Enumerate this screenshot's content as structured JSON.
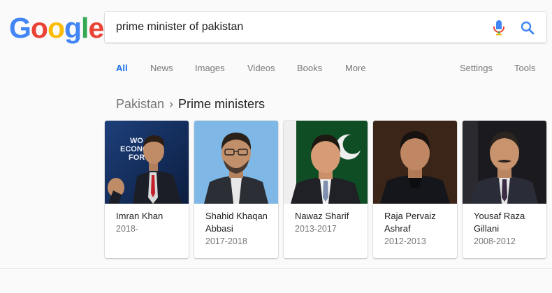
{
  "logo": {
    "letters": [
      {
        "char": "G",
        "color": "#4285F4"
      },
      {
        "char": "o",
        "color": "#EA4335"
      },
      {
        "char": "o",
        "color": "#FBBC05"
      },
      {
        "char": "g",
        "color": "#4285F4"
      },
      {
        "char": "l",
        "color": "#34A853"
      },
      {
        "char": "e",
        "color": "#EA4335"
      }
    ]
  },
  "search": {
    "query": "prime minister of pakistan",
    "mic_icon": "microphone-icon",
    "search_icon": "magnifier-icon"
  },
  "tabs": {
    "all": "All",
    "news": "News",
    "images": "Images",
    "videos": "Videos",
    "books": "Books",
    "more": "More",
    "settings": "Settings",
    "tools": "Tools"
  },
  "breadcrumb": {
    "parent": "Pakistan",
    "separator": "›",
    "current": "Prime ministers"
  },
  "cards": [
    {
      "name": "Imran Khan",
      "years": "2018-"
    },
    {
      "name": "Shahid Khaqan Abbasi",
      "years": "2017-2018"
    },
    {
      "name": "Nawaz Sharif",
      "years": "2013-2017"
    },
    {
      "name": "Raja Pervaiz Ashraf",
      "years": "2012-2013"
    },
    {
      "name": "Yousaf Raza Gillani",
      "years": "2008-2012"
    }
  ],
  "photo_texts": {
    "forum_line1": "WO",
    "forum_line2": "ECONO",
    "forum_line3": "FORU"
  },
  "colors": {
    "accent_blue": "#1a73e8",
    "muted_text": "#777777",
    "page_bg": "#fafafa"
  }
}
